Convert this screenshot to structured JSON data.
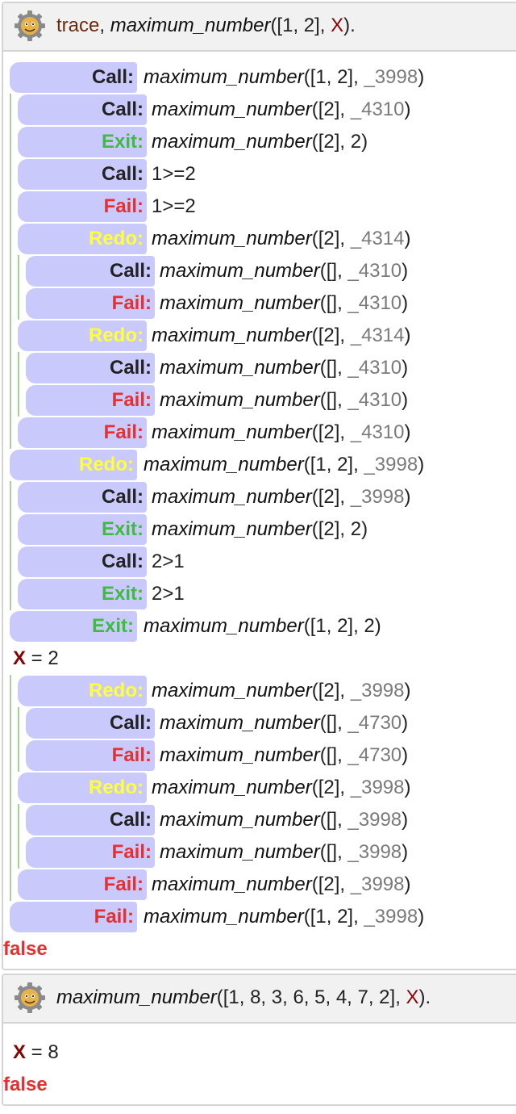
{
  "colors": {
    "call": "#222222",
    "exit": "#3fbb3f",
    "fail": "#e53030",
    "redo": "#ffff3a",
    "port_background": "#c9c9fb",
    "trace_line": "#a9cf9f",
    "variable": "#8b0000"
  },
  "query1": {
    "icon": "swi-prolog-gear-icon",
    "trace_word": "trace",
    "sep": ", ",
    "goal_name": "maximum_number",
    "args_open": "([1, 2], ",
    "var": "X",
    "args_close": ")."
  },
  "trace_lines": [
    {
      "port": "Call:",
      "kind": "call",
      "depth": 0,
      "goal": "maximum_number",
      "args": "([1, 2], ",
      "var": "_3998",
      "tail": ")",
      "style": "italic"
    },
    {
      "port": "Call:",
      "kind": "call",
      "depth": 1,
      "goal": "maximum_number",
      "args": "([2], ",
      "var": "_4310",
      "tail": ")",
      "style": "italic"
    },
    {
      "port": "Exit:",
      "kind": "exit",
      "depth": 1,
      "goal": "maximum_number",
      "args": "([2], 2)",
      "var": "",
      "tail": "",
      "style": "italic"
    },
    {
      "port": "Call:",
      "kind": "call",
      "depth": 1,
      "goal": "1>=2",
      "args": "",
      "var": "",
      "tail": "",
      "style": "plain"
    },
    {
      "port": "Fail:",
      "kind": "fail",
      "depth": 1,
      "goal": "1>=2",
      "args": "",
      "var": "",
      "tail": "",
      "style": "plain"
    },
    {
      "port": "Redo:",
      "kind": "redo",
      "depth": 1,
      "goal": "maximum_number",
      "args": "([2], ",
      "var": "_4314",
      "tail": ")",
      "style": "italic"
    },
    {
      "port": "Call:",
      "kind": "call",
      "depth": 2,
      "goal": "maximum_number",
      "args": "([], ",
      "var": "_4310",
      "tail": ")",
      "style": "italic"
    },
    {
      "port": "Fail:",
      "kind": "fail",
      "depth": 2,
      "goal": "maximum_number",
      "args": "([], ",
      "var": "_4310",
      "tail": ")",
      "style": "italic"
    },
    {
      "port": "Redo:",
      "kind": "redo",
      "depth": 1,
      "goal": "maximum_number",
      "args": "([2], ",
      "var": "_4314",
      "tail": ")",
      "style": "italic"
    },
    {
      "port": "Call:",
      "kind": "call",
      "depth": 2,
      "goal": "maximum_number",
      "args": "([], ",
      "var": "_4310",
      "tail": ")",
      "style": "italic"
    },
    {
      "port": "Fail:",
      "kind": "fail",
      "depth": 2,
      "goal": "maximum_number",
      "args": "([], ",
      "var": "_4310",
      "tail": ")",
      "style": "italic"
    },
    {
      "port": "Fail:",
      "kind": "fail",
      "depth": 1,
      "goal": "maximum_number",
      "args": "([2], ",
      "var": "_4310",
      "tail": ")",
      "style": "italic"
    },
    {
      "port": "Redo:",
      "kind": "redo",
      "depth": 0,
      "goal": "maximum_number",
      "args": "([1, 2], ",
      "var": "_3998",
      "tail": ")",
      "style": "italic"
    },
    {
      "port": "Call:",
      "kind": "call",
      "depth": 1,
      "goal": "maximum_number",
      "args": "([2], ",
      "var": "_3998",
      "tail": ")",
      "style": "italic"
    },
    {
      "port": "Exit:",
      "kind": "exit",
      "depth": 1,
      "goal": "maximum_number",
      "args": "([2], 2)",
      "var": "",
      "tail": "",
      "style": "italic"
    },
    {
      "port": "Call:",
      "kind": "call",
      "depth": 1,
      "goal": "2>1",
      "args": "",
      "var": "",
      "tail": "",
      "style": "plain"
    },
    {
      "port": "Exit:",
      "kind": "exit",
      "depth": 1,
      "goal": "2>1",
      "args": "",
      "var": "",
      "tail": "",
      "style": "plain"
    },
    {
      "port": "Exit:",
      "kind": "exit",
      "depth": 0,
      "goal": "maximum_number",
      "args": "([1, 2], 2)",
      "var": "",
      "tail": "",
      "style": "italic"
    },
    {
      "binding": true,
      "var": "X",
      "eq": " = ",
      "value": "2"
    },
    {
      "port": "Redo:",
      "kind": "redo",
      "depth": 1,
      "goal": "maximum_number",
      "args": "([2], ",
      "var": "_3998",
      "tail": ")",
      "style": "italic"
    },
    {
      "port": "Call:",
      "kind": "call",
      "depth": 2,
      "goal": "maximum_number",
      "args": "([], ",
      "var": "_4730",
      "tail": ")",
      "style": "italic"
    },
    {
      "port": "Fail:",
      "kind": "fail",
      "depth": 2,
      "goal": "maximum_number",
      "args": "([], ",
      "var": "_4730",
      "tail": ")",
      "style": "italic"
    },
    {
      "port": "Redo:",
      "kind": "redo",
      "depth": 1,
      "goal": "maximum_number",
      "args": "([2], ",
      "var": "_3998",
      "tail": ")",
      "style": "italic"
    },
    {
      "port": "Call:",
      "kind": "call",
      "depth": 2,
      "goal": "maximum_number",
      "args": "([], ",
      "var": "_3998",
      "tail": ")",
      "style": "italic"
    },
    {
      "port": "Fail:",
      "kind": "fail",
      "depth": 2,
      "goal": "maximum_number",
      "args": "([], ",
      "var": "_3998",
      "tail": ")",
      "style": "italic"
    },
    {
      "port": "Fail:",
      "kind": "fail",
      "depth": 1,
      "goal": "maximum_number",
      "args": "([2], ",
      "var": "_3998",
      "tail": ")",
      "style": "italic"
    },
    {
      "port": "Fail:",
      "kind": "fail",
      "depth": 0,
      "goal": "maximum_number",
      "args": "([1, 2], ",
      "var": "_3998",
      "tail": ")",
      "style": "italic"
    }
  ],
  "result1": "false",
  "query2": {
    "icon": "swi-prolog-gear-icon",
    "goal_name": "maximum_number",
    "args_open": "([1, 8, 3, 6, 5, 4, 7, 2], ",
    "var": "X",
    "args_close": ")."
  },
  "answer2": {
    "var": "X",
    "eq": " = ",
    "value": "8"
  },
  "result2": "false"
}
